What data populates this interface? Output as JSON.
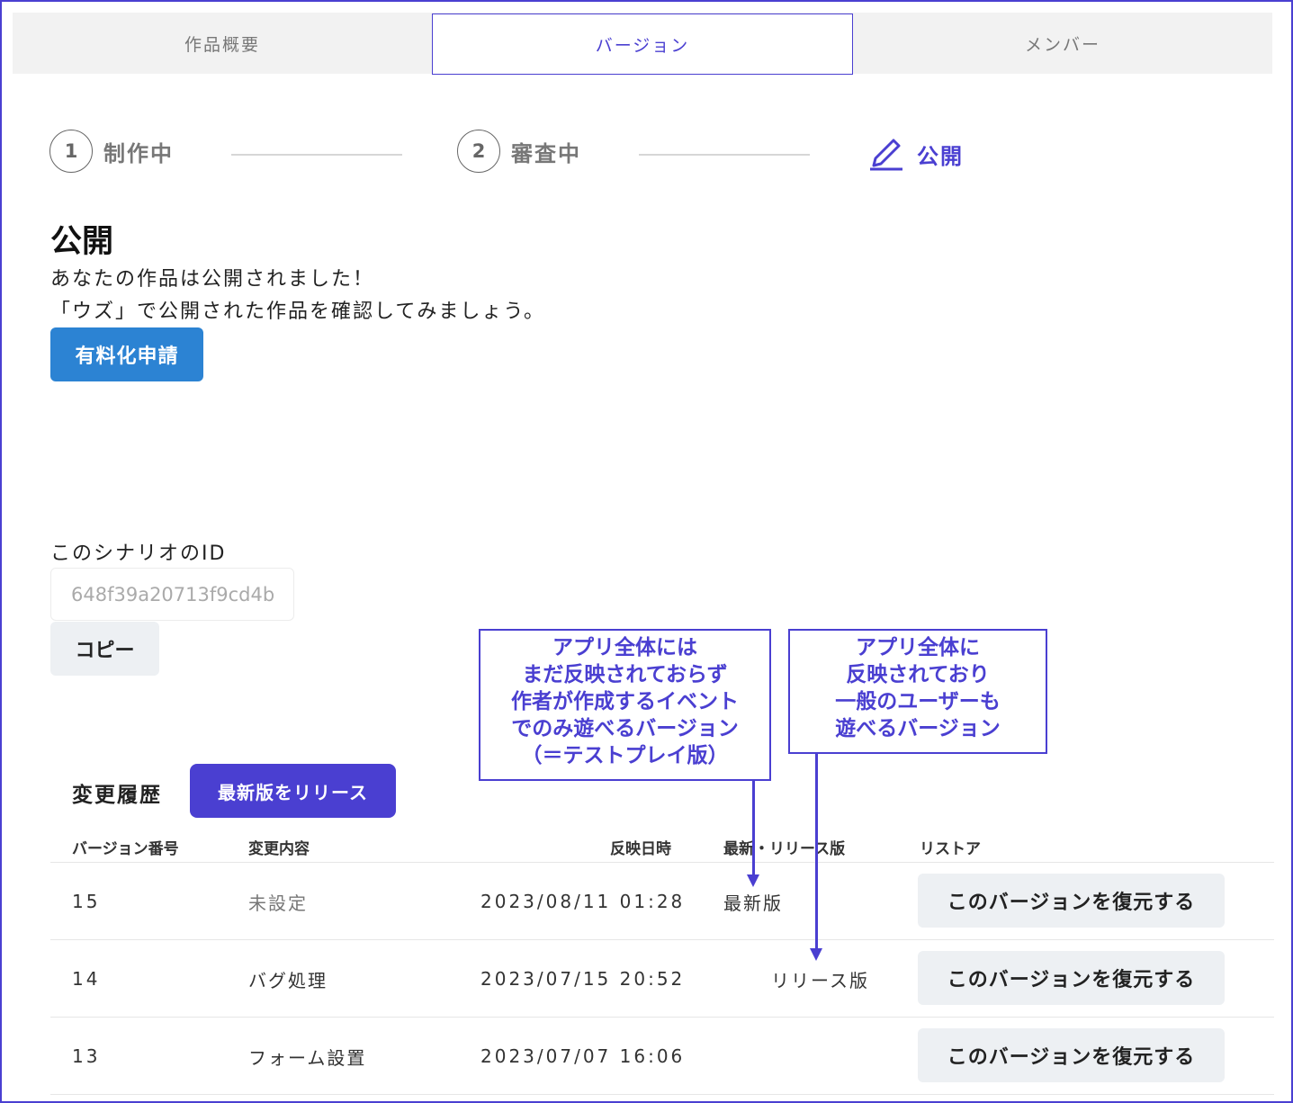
{
  "tabs": [
    {
      "label": "作品概要",
      "active": false
    },
    {
      "label": "バージョン",
      "active": true
    },
    {
      "label": "メンバー",
      "active": false
    }
  ],
  "stepper": {
    "step1": {
      "number": "1",
      "label": "制作中"
    },
    "step2": {
      "number": "2",
      "label": "審査中"
    },
    "step3": {
      "icon": "pencil-icon",
      "label": "公開"
    }
  },
  "published": {
    "title": "公開",
    "message_line1": "あなたの作品は公開されました！",
    "message_line2": "「ウズ」で公開された作品を確認してみましょう。",
    "paid_button": "有料化申請"
  },
  "scenario_id": {
    "label": "このシナリオのID",
    "value": "648f39a20713f9cd4b",
    "copy_button": "コピー"
  },
  "history": {
    "label": "変更履歴",
    "release_button": "最新版をリリース",
    "columns": {
      "version": "バージョン番号",
      "changes": "変更内容",
      "date": "反映日時",
      "latest_release": "最新・リリース版",
      "restore": "リストア"
    },
    "rows": [
      {
        "version": "15",
        "changes": "未設定",
        "date": "2023/08/11 01:28",
        "status": "最新版",
        "restore": "このバージョンを復元する"
      },
      {
        "version": "14",
        "changes": "バグ処理",
        "date": "2023/07/15 20:52",
        "status": "リリース版",
        "restore": "このバージョンを復元する"
      },
      {
        "version": "13",
        "changes": "フォーム設置",
        "date": "2023/07/07 16:06",
        "status": "",
        "restore": "このバージョンを復元する"
      }
    ]
  },
  "annotations": {
    "note1": [
      "アプリ全体には",
      "まだ反映されておらず",
      "作者が作成するイベント",
      "でのみ遊べるバージョン",
      "（＝テストプレイ版）"
    ],
    "note2": [
      "アプリ全体に",
      "反映されており",
      "一般のユーザーも",
      "遊べるバージョン"
    ]
  },
  "colors": {
    "accent": "#4a3fd1",
    "primary_blue": "#2c83d3",
    "tab_bg": "#f2f2f2",
    "button_grey": "#edf0f3"
  }
}
